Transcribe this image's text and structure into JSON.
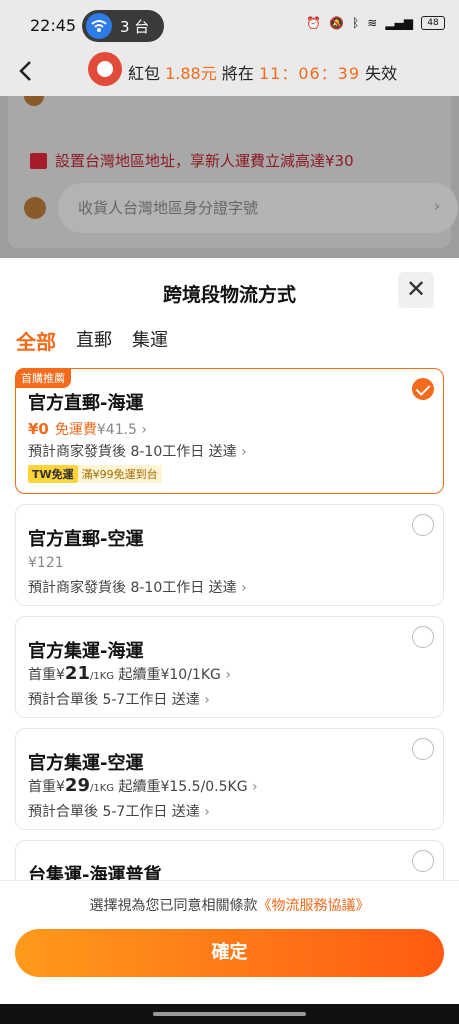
{
  "status_bar": {
    "time": "22:45",
    "hotspot_count": "3 台",
    "battery": "48",
    "icons": [
      "alarm-icon",
      "mute-icon",
      "bluetooth-icon",
      "wifi-icon",
      "signal-icon",
      "battery-icon"
    ]
  },
  "header": {
    "prefix": "紅包",
    "amount": "1.88元",
    "middle": "將在",
    "countdown": "11：06：39",
    "suffix": "失效"
  },
  "background": {
    "promo_text": "設置台灣地區地址，享新人運費立減高達¥30",
    "id_placeholder": "收貨人台灣地區身分證字號"
  },
  "sheet": {
    "title": "跨境段物流方式",
    "tabs": [
      {
        "label": "全部",
        "active": true
      },
      {
        "label": "直郵",
        "active": false
      },
      {
        "label": "集運",
        "active": false
      }
    ],
    "options": [
      {
        "badge": "首購推薦",
        "name": "官方直郵-海運",
        "price": "¥0",
        "free_label": "免運費",
        "original_price": "¥41.5",
        "eta": "預計商家發貨後 8-10工作日 送達",
        "tag": "TW免運",
        "tag_note": "滿¥99免運到台",
        "selected": true
      },
      {
        "name": "官方直郵-空運",
        "price": "¥121",
        "eta": "預計商家發貨後 8-10工作日 送達",
        "selected": false
      },
      {
        "name": "官方集運-海運",
        "first_prefix": "首重¥",
        "first_value": "21",
        "first_unit": "/1KG",
        "cont": "起續重¥10/1KG",
        "eta": "預計合單後 5-7工作日 送達",
        "selected": false
      },
      {
        "name": "官方集運-空運",
        "first_prefix": "首重¥",
        "first_value": "29",
        "first_unit": "/1KG",
        "cont": "起續重¥15.5/0.5KG",
        "eta": "預計合單後 5-7工作日 送達",
        "selected": false
      },
      {
        "name": "台集運-海運普貨",
        "selected": false
      }
    ]
  },
  "footer": {
    "agreement": "選擇視為您已同意相關條款",
    "agreement_link": "《物流服務協議》",
    "confirm": "確定"
  },
  "colors": {
    "accent": "#f36b1b",
    "confirm_start": "#ff9a1c",
    "confirm_end": "#ff5a12",
    "tw_tag": "#ffd43a"
  }
}
